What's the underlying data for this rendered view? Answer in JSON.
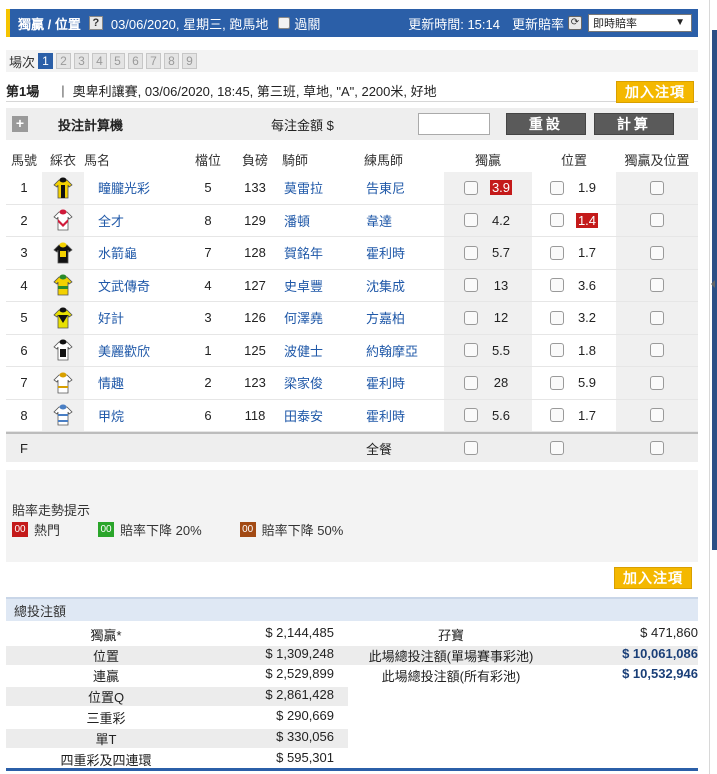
{
  "header": {
    "title": "獨贏 / 位置",
    "help_icon": "?",
    "date": "03/06/2020, 星期三, 跑馬地",
    "past_label": "過關",
    "update_time": "更新時間: 15:14",
    "update_rate": "更新賠率",
    "odds_mode": "即時賠率"
  },
  "races": {
    "label": "場次",
    "numbers": [
      "1",
      "2",
      "3",
      "4",
      "5",
      "6",
      "7",
      "8",
      "9"
    ],
    "active": "1"
  },
  "race_info": {
    "race_no": "第1場",
    "separator": "|",
    "description": "奧卑利讓賽, 03/06/2020, 18:45, 第三班, 草地, \"A\", 2200米, 好地",
    "add_bet": "加入注項"
  },
  "calculator": {
    "title": "投注計算機",
    "unit_label": "每注金額 $",
    "reset": "重設",
    "compute": "計算"
  },
  "table": {
    "headers": {
      "no": "馬號",
      "silk": "綵衣",
      "name": "馬名",
      "draw": "檔位",
      "weight": "負磅",
      "jockey": "騎師",
      "trainer": "練馬師",
      "win": "獨贏",
      "place": "位置",
      "win_place": "獨贏及位置"
    },
    "rows": [
      {
        "no": "1",
        "name": "疃朧光彩",
        "draw": "5",
        "weight": "133",
        "jockey": "莫雷拉",
        "trainer": "告東尼",
        "win": "3.9",
        "place": "1.9",
        "win_hot": true,
        "place_hot": false
      },
      {
        "no": "2",
        "name": "全才",
        "draw": "8",
        "weight": "129",
        "jockey": "潘頓",
        "trainer": "韋達",
        "win": "4.2",
        "place": "1.4",
        "win_hot": false,
        "place_hot": true
      },
      {
        "no": "3",
        "name": "水箭龜",
        "draw": "7",
        "weight": "128",
        "jockey": "賀銘年",
        "trainer": "霍利時",
        "win": "5.7",
        "place": "1.7",
        "win_hot": false,
        "place_hot": false
      },
      {
        "no": "4",
        "name": "文武傳奇",
        "draw": "4",
        "weight": "127",
        "jockey": "史卓豐",
        "trainer": "沈集成",
        "win": "13",
        "place": "3.6",
        "win_hot": false,
        "place_hot": false
      },
      {
        "no": "5",
        "name": "好計",
        "draw": "3",
        "weight": "126",
        "jockey": "何澤堯",
        "trainer": "方嘉柏",
        "win": "12",
        "place": "3.2",
        "win_hot": false,
        "place_hot": false
      },
      {
        "no": "6",
        "name": "美麗歡欣",
        "draw": "1",
        "weight": "125",
        "jockey": "波健士",
        "trainer": "約翰摩亞",
        "win": "5.5",
        "place": "1.8",
        "win_hot": false,
        "place_hot": false
      },
      {
        "no": "7",
        "name": "情趣",
        "draw": "2",
        "weight": "123",
        "jockey": "梁家俊",
        "trainer": "霍利時",
        "win": "28",
        "place": "5.9",
        "win_hot": false,
        "place_hot": false
      },
      {
        "no": "8",
        "name": "甲烷",
        "draw": "6",
        "weight": "118",
        "jockey": "田泰安",
        "trainer": "霍利時",
        "win": "5.6",
        "place": "1.7",
        "win_hot": false,
        "place_hot": false
      }
    ],
    "field_row": {
      "no": "F",
      "label": "全餐"
    }
  },
  "silks": [
    {
      "body": "#f3d100",
      "accent": "#111111"
    },
    {
      "body": "#ffffff",
      "accent": "#d01a3a"
    },
    {
      "body": "#111111",
      "accent": "#f3d100"
    },
    {
      "body": "#f3d100",
      "accent": "#2a8a2a"
    },
    {
      "body": "#e8e000",
      "accent": "#111111"
    },
    {
      "body": "#ffffff",
      "accent": "#111111"
    },
    {
      "body": "#ffffff",
      "accent": "#d8a000"
    },
    {
      "body": "#ffffff",
      "accent": "#4a7fc4"
    }
  ],
  "trend": {
    "title": "賠率走勢提示",
    "items": [
      {
        "tag": "00",
        "color": "red",
        "label": "熱門"
      },
      {
        "tag": "00",
        "color": "green",
        "label": "賠率下降 20%"
      },
      {
        "tag": "00",
        "color": "brown",
        "label": "賠率下降 50%"
      }
    ]
  },
  "add_bet_bottom": "加入注項",
  "totals": {
    "title": "總投注額",
    "left": [
      {
        "label": "獨贏*",
        "value": "$ 2,144,485"
      },
      {
        "label": "位置",
        "value": "$ 1,309,248"
      },
      {
        "label": "連贏",
        "value": "$ 2,529,899"
      },
      {
        "label": "位置Q",
        "value": "$ 2,861,428"
      },
      {
        "label": "三重彩",
        "value": "$ 290,669"
      },
      {
        "label": "單T",
        "value": "$ 330,056"
      },
      {
        "label": "四重彩及四連環",
        "value": "$ 595,301"
      }
    ],
    "right": [
      {
        "label": "孖寶",
        "value": "$ 471,860",
        "bold": false
      },
      {
        "label": "此場總投注額(單場賽事彩池)",
        "value": "$ 10,061,086",
        "bold": true
      },
      {
        "label": "此場總投注額(所有彩池)",
        "value": "$ 10,532,946",
        "bold": true
      }
    ]
  },
  "colors": {
    "primary": "#2b5fa8",
    "gold": "#f4b800",
    "hot": "#c41a1a",
    "link": "#1f58a8"
  }
}
